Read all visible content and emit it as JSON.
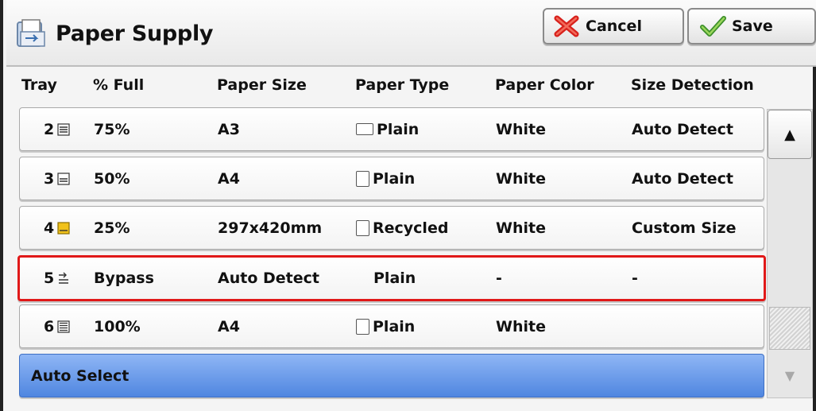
{
  "header": {
    "title": "Paper Supply",
    "title_icon": "paper-supply-icon",
    "cancel_label": "Cancel",
    "save_label": "Save"
  },
  "columns": [
    "Tray",
    "% Full",
    "Paper Size",
    "Paper Type",
    "Paper Color",
    "Size Detection"
  ],
  "rows": [
    {
      "tray": "2",
      "tray_icon": "tray-level-icon",
      "full": "75%",
      "size": "A3",
      "type": "Plain",
      "type_icon": "landscape-paper-icon",
      "color": "White",
      "detection": "Auto Detect"
    },
    {
      "tray": "3",
      "tray_icon": "tray-level-icon",
      "full": "50%",
      "size": "A4",
      "type": "Plain",
      "type_icon": "portrait-paper-icon",
      "color": "White",
      "detection": "Auto Detect"
    },
    {
      "tray": "4",
      "tray_icon": "tray-low-icon",
      "full": "25%",
      "size": "297x420mm",
      "type": "Recycled",
      "type_icon": "portrait-paper-icon",
      "color": "White",
      "detection": "Custom Size"
    },
    {
      "tray": "5",
      "tray_icon": "bypass-tray-icon",
      "full": "Bypass",
      "size": "Auto Detect",
      "type": "Plain",
      "type_icon": "",
      "color": "-",
      "detection": "-"
    },
    {
      "tray": "6",
      "tray_icon": "tray-level-icon",
      "full": "100%",
      "size": "A4",
      "type": "Plain",
      "type_icon": "portrait-paper-icon",
      "color": "White",
      "detection": ""
    }
  ],
  "auto_select_label": "Auto Select",
  "colors": {
    "selected_border": "#e01818",
    "auto_select_bg": "#5b8fe6",
    "tray_low": "#f1c21b"
  }
}
